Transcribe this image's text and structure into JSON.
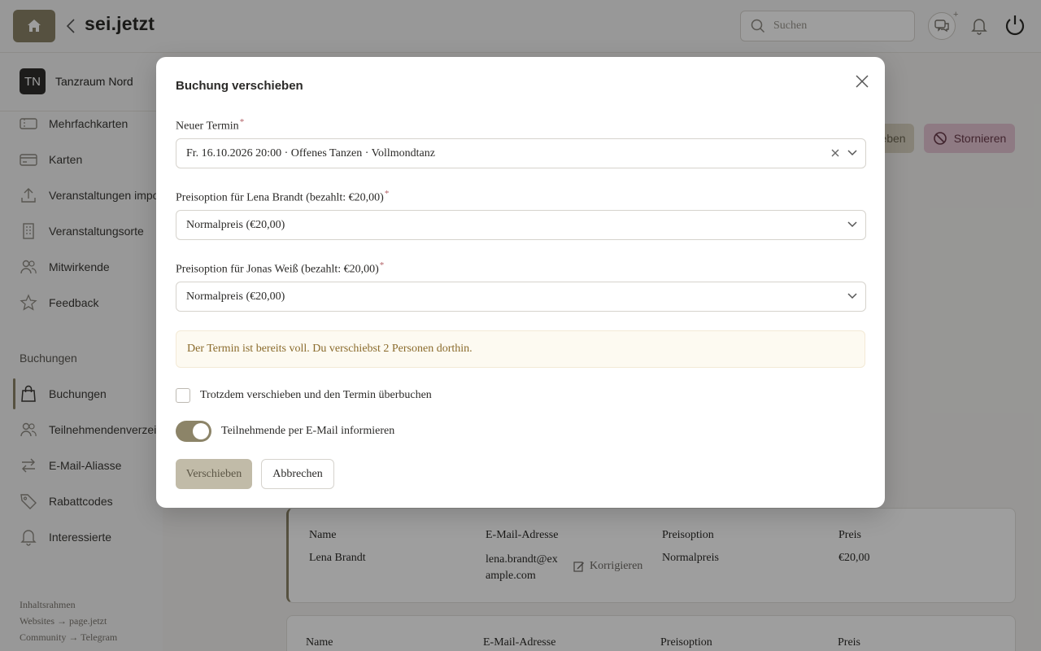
{
  "app": {
    "brand": "sei.jetzt"
  },
  "header": {
    "search_placeholder": "Suchen",
    "chat_badge": "+"
  },
  "sidebar": {
    "org_initials": "TN",
    "org_name": "Tanzraum Nord",
    "items": [
      {
        "label": "Mehrfachkarten",
        "icon": "ticket-icon"
      },
      {
        "label": "Karten",
        "icon": "card-icon"
      },
      {
        "label": "Veranstaltungen importieren",
        "icon": "upload-icon"
      },
      {
        "label": "Veranstaltungsorte",
        "icon": "building-icon"
      },
      {
        "label": "Mitwirkende",
        "icon": "people-icon"
      },
      {
        "label": "Feedback",
        "icon": "star-icon"
      }
    ],
    "section_title": "Buchungen",
    "section_items": [
      {
        "label": "Buchungen",
        "icon": "bag-icon"
      },
      {
        "label": "Teilnehmendenverzeichnis",
        "icon": "people-icon"
      },
      {
        "label": "E-Mail-Aliasse",
        "icon": "swap-icon"
      },
      {
        "label": "Rabattcodes",
        "icon": "tag-icon"
      },
      {
        "label": "Interessierte",
        "icon": "bell-icon"
      }
    ],
    "footer_links": [
      "Inhaltsrahmen",
      "Websites → page.jetzt",
      "Community → Telegram"
    ]
  },
  "main": {
    "ghost_button": "eben",
    "cancel_button": "Stornieren",
    "table_headers": [
      "Name",
      "E-Mail-Adresse",
      "Preisoption",
      "Preis"
    ],
    "rows": [
      {
        "name": "Lena Brandt",
        "email_line1": "lena.brandt@ex",
        "email_line2": "ample.com",
        "correct": "Korrigieren",
        "option": "Normalpreis",
        "price": "€20,00"
      }
    ]
  },
  "modal": {
    "title": "Buchung verschieben",
    "new_date_label": "Neuer Termin",
    "new_date_value": "Fr. 16.10.2026 20:00 · Offenes Tanzen · Vollmondtanz",
    "price_label_1": "Preisoption für Lena Brandt (bezahlt: €20,00)",
    "price_value_1": "Normalpreis (€20,00)",
    "price_label_2": "Preisoption für Jonas Weiß (bezahlt: €20,00)",
    "price_value_2": "Normalpreis (€20,00)",
    "required_mark": "*",
    "warning": "Der Termin ist bereits voll. Du verschiebst 2 Personen dorthin.",
    "overbook_label": "Trotzdem verschieben und den Termin überbuchen",
    "notify_label": "Teilnehmende per E-Mail informieren",
    "notify_on": true,
    "submit_label": "Verschieben",
    "cancel_label": "Abbrechen"
  },
  "colors": {
    "accent": "#8c8468",
    "danger_bg": "#e6c6d4",
    "warning_text": "#8a6b2c"
  }
}
